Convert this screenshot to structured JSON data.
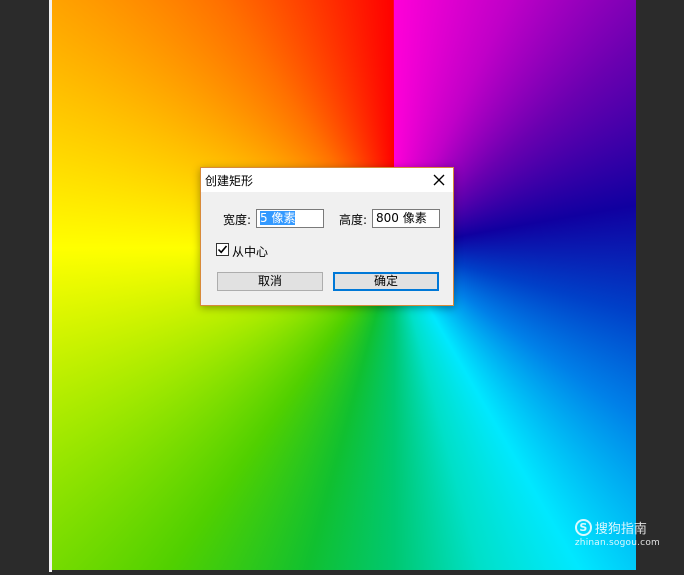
{
  "dialog": {
    "title": "创建矩形",
    "width_label": "宽度:",
    "width_value": "5 像素",
    "height_label": "高度:",
    "height_value": "800 像素",
    "from_center_label": "从中心",
    "from_center_checked": true,
    "cancel_label": "取消",
    "ok_label": "确定"
  },
  "watermark": {
    "logo_letter": "S",
    "text": "搜狗指南",
    "url": "zhinan.sogou.com"
  },
  "colors": {
    "workspace_bg": "#2b2b2b",
    "dialog_border": "#d88a3a",
    "primary_button_border": "#0078d7",
    "selection": "#3399ff"
  }
}
